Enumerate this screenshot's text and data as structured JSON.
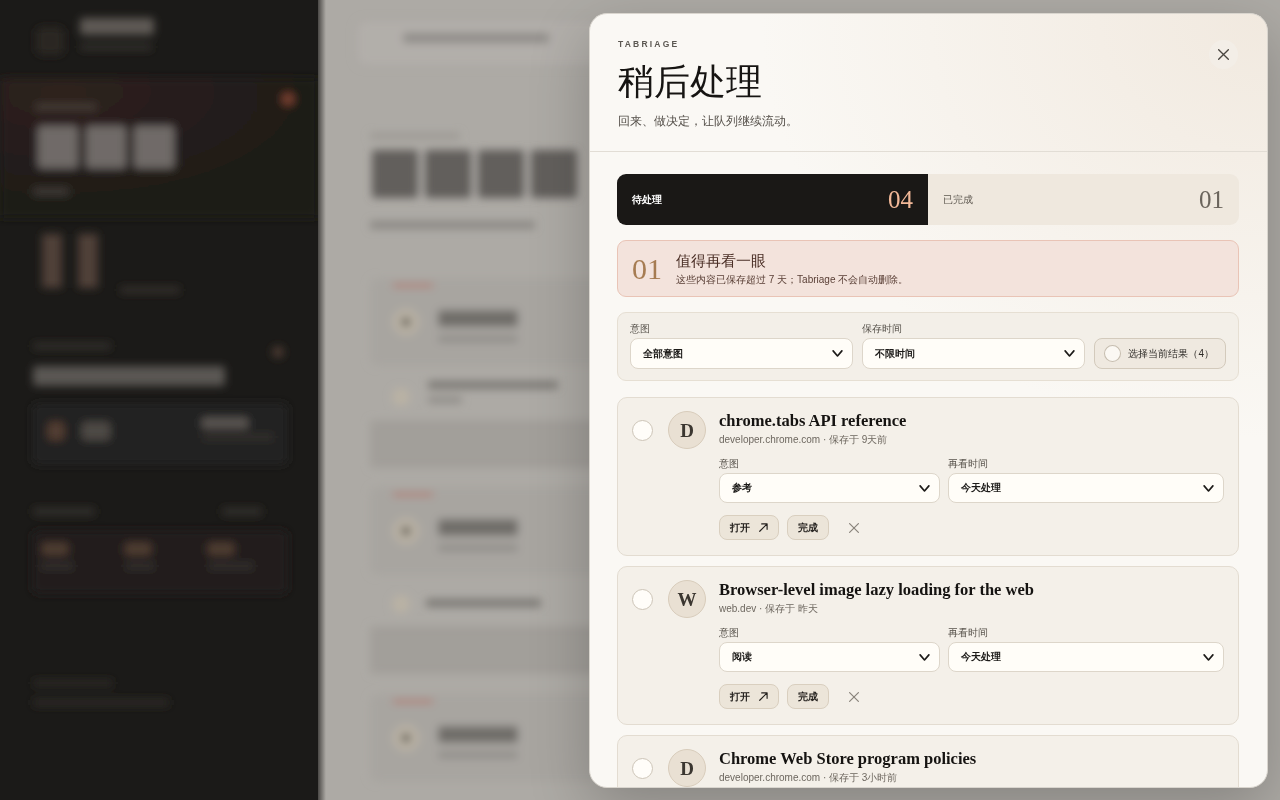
{
  "dialog": {
    "brand": "TABRIAGE",
    "title": "稍后处理",
    "subtitle": "回来、做决定，让队列继续流动。"
  },
  "tabs": [
    {
      "label": "待处理",
      "count": "04",
      "selected": true
    },
    {
      "label": "已完成",
      "count": "01",
      "selected": false
    }
  ],
  "notice": {
    "count": "01",
    "title": "值得再看一眼",
    "text": "这些内容已保存超过 7 天；Tabriage 不会自动删除。"
  },
  "filters": {
    "fields": [
      {
        "label": "意图",
        "value": "全部意图"
      },
      {
        "label": "保存时间",
        "value": "不限时间"
      }
    ],
    "select_all": {
      "label": "选择当前结果（4）",
      "checked": false
    }
  },
  "items": [
    {
      "initial": "D",
      "title": "chrome.tabs API reference",
      "meta": "developer.chrome.com · 保存于 9天前",
      "selected": false,
      "fields": [
        {
          "label": "意图",
          "value": "参考"
        },
        {
          "label": "再看时间",
          "value": "今天处理"
        }
      ],
      "actions": [
        {
          "kind": "open",
          "label": "打开"
        },
        {
          "kind": "done",
          "label": "完成"
        },
        {
          "kind": "remove"
        }
      ]
    },
    {
      "initial": "W",
      "title": "Browser-level image lazy loading for the web",
      "meta": "web.dev · 保存于 昨天",
      "selected": false,
      "fields": [
        {
          "label": "意图",
          "value": "阅读"
        },
        {
          "label": "再看时间",
          "value": "今天处理"
        }
      ],
      "actions": [
        {
          "kind": "open",
          "label": "打开"
        },
        {
          "kind": "done",
          "label": "完成"
        },
        {
          "kind": "remove"
        }
      ]
    },
    {
      "initial": "D",
      "title": "Chrome Web Store program policies",
      "meta": "developer.chrome.com · 保存于 3小时前",
      "selected": false
    }
  ]
}
